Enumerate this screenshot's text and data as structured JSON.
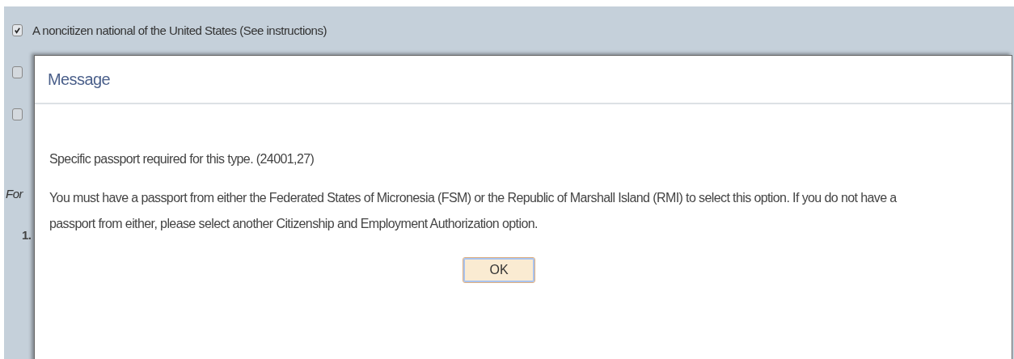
{
  "background_form": {
    "options": [
      {
        "label": "A noncitizen national of the United States (See instructions)",
        "checked": true
      },
      {
        "checked": false
      },
      {
        "checked": false
      }
    ],
    "fragments": [
      {
        "kind": "italic",
        "text": "For"
      },
      {
        "kind": "number",
        "text": "1."
      }
    ]
  },
  "dialog": {
    "title": "Message",
    "messages": [
      "Specific passport required for this type. (24001,27)",
      "You must have a passport from either the Federated States of Micronesia (FSM) or the Republic of Marshall Island (RMI) to select this option.  If you do not have a passport from either, please select another Citizenship and Employment Authorization option."
    ],
    "buttons": [
      "OK"
    ]
  }
}
